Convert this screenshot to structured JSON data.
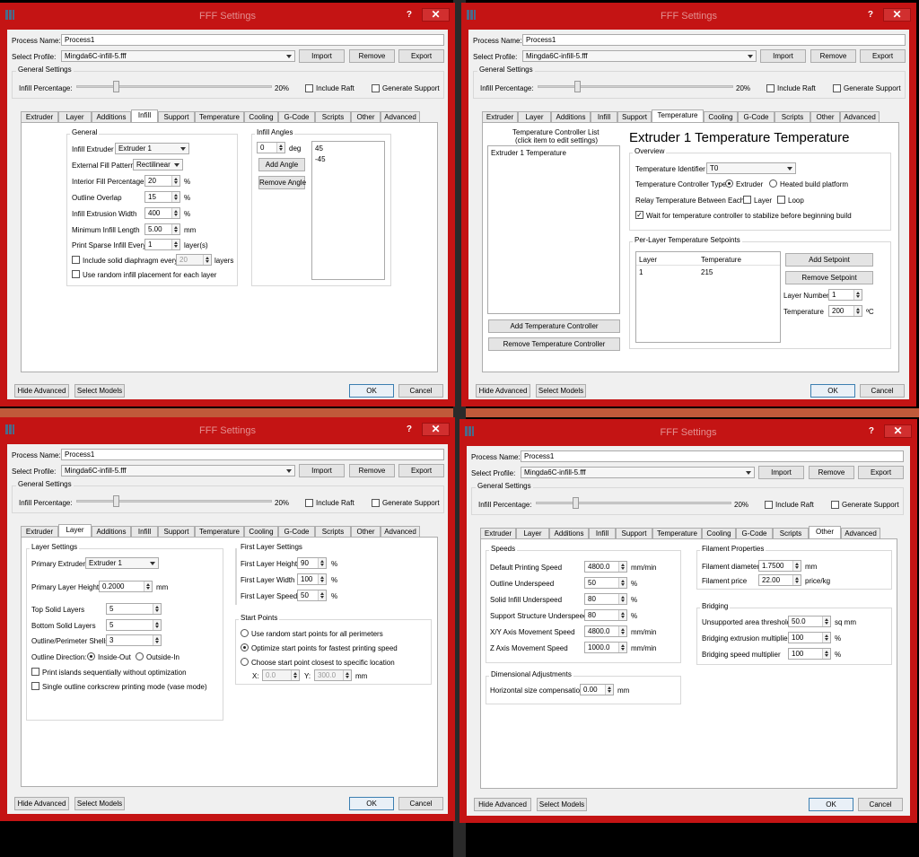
{
  "common": {
    "window_title": "FFF Settings",
    "help": "?",
    "close": "✕",
    "process_label": "Process Name:",
    "process_value": "Process1",
    "profile_label": "Select Profile:",
    "profile_value": "Mingda6C-infill-5.fff",
    "import": "Import",
    "remove": "Remove",
    "export": "Export",
    "general_settings": "General Settings",
    "infill_pct_label": "Infill Percentage:",
    "infill_pct_value": "20%",
    "infill_level": 0.2,
    "include_raft": "Include Raft",
    "generate_support": "Generate Support",
    "hide_advanced": "Hide Advanced",
    "select_models": "Select Models",
    "ok": "OK",
    "cancel": "Cancel"
  },
  "tabs": {
    "extruder": "Extruder",
    "layer": "Layer",
    "additions": "Additions",
    "infill": "Infill",
    "support": "Support",
    "temperature": "Temperature",
    "cooling": "Cooling",
    "gcode": "G-Code",
    "scripts": "Scripts",
    "other": "Other",
    "advanced": "Advanced"
  },
  "infill": {
    "group_general": "General",
    "extruder_label": "Infill Extruder",
    "extruder_value": "Extruder 1",
    "pattern_label": "External Fill Pattern",
    "pattern_value": "Rectilinear",
    "interior_label": "Interior Fill Percentage",
    "interior_value": "20",
    "outline_label": "Outline Overlap",
    "outline_value": "15",
    "width_label": "Infill Extrusion Width",
    "width_value": "400",
    "min_len_label": "Minimum Infill Length",
    "min_len_value": "5.00",
    "unit_pct": "%",
    "unit_mm": "mm",
    "sparse_label": "Print Sparse Infill Every",
    "sparse_value": "1",
    "sparse_unit": "layer(s)",
    "diaphragm_label": "Include solid diaphragm every",
    "diaphragm_value": "20",
    "diaphragm_unit": "layers",
    "random_label": "Use random infill placement for each layer",
    "group_angles": "Infill Angles",
    "angle_value": "0",
    "angle_unit": "deg",
    "add_angle": "Add Angle",
    "remove_angle": "Remove Angle",
    "angles": [
      "45",
      "-45"
    ]
  },
  "temperature": {
    "list_title": "Temperature Controller List",
    "list_sub": "(click item to edit settings)",
    "list_items": [
      "Extruder 1 Temperature"
    ],
    "add_ctrl": "Add Temperature Controller",
    "remove_ctrl": "Remove Temperature Controller",
    "title": "Extruder 1 Temperature Temperature",
    "group_overview": "Overview",
    "id_label": "Temperature Identifier",
    "id_value": "T0",
    "type_label": "Temperature Controller Type:",
    "type_extruder": "Extruder",
    "type_bed": "Heated build platform",
    "relay_label": "Relay Temperature Between Each:",
    "relay_layer": "Layer",
    "relay_loop": "Loop",
    "wait_label": "Wait for temperature controller to stabilize before beginning build",
    "group_setpoints": "Per-Layer Temperature Setpoints",
    "col_layer": "Layer",
    "col_temp": "Temperature",
    "rows": [
      {
        "layer": "1",
        "temp": "215"
      }
    ],
    "add_setpoint": "Add Setpoint",
    "remove_setpoint": "Remove Setpoint",
    "layer_num_label": "Layer Number",
    "layer_num_value": "1",
    "temp_label": "Temperature",
    "temp_value": "200",
    "temp_unit": "ºC"
  },
  "layer": {
    "group_layer": "Layer Settings",
    "primary_label": "Primary Extruder",
    "primary_value": "Extruder 1",
    "height_label": "Primary Layer Height",
    "height_value": "0.2000",
    "height_unit": "mm",
    "top_label": "Top Solid Layers",
    "top_value": "5",
    "bottom_label": "Bottom Solid Layers",
    "bottom_value": "5",
    "shells_label": "Outline/Perimeter Shells",
    "shells_value": "3",
    "direction_label": "Outline Direction:",
    "dir_in": "Inside-Out",
    "dir_out": "Outside-In",
    "islands_label": "Print islands sequentially without optimization",
    "vase_label": "Single outline corkscrew printing mode (vase mode)",
    "group_first": "First Layer Settings",
    "fl_height_label": "First Layer Height",
    "fl_height_value": "90",
    "fl_width_label": "First Layer Width",
    "fl_width_value": "100",
    "fl_speed_label": "First Layer Speed",
    "fl_speed_value": "50",
    "unit_pct": "%",
    "group_start": "Start Points",
    "sp_random": "Use random start points for all perimeters",
    "sp_optimize": "Optimize start points for fastest printing speed",
    "sp_closest": "Choose start point closest to specific location",
    "x_label": "X:",
    "x_value": "0.0",
    "y_label": "Y:",
    "y_value": "300.0",
    "xy_unit": "mm"
  },
  "other": {
    "group_speeds": "Speeds",
    "default_label": "Default Printing Speed",
    "default_value": "4800.0",
    "outline_label": "Outline Underspeed",
    "outline_value": "50",
    "solid_label": "Solid Infill Underspeed",
    "solid_value": "80",
    "support_label": "Support Structure Underspeed",
    "support_value": "80",
    "xy_label": "X/Y Axis Movement Speed",
    "xy_value": "4800.0",
    "z_label": "Z Axis Movement Speed",
    "z_value": "1000.0",
    "unit_mmmin": "mm/min",
    "unit_pct": "%",
    "unit_mm": "mm",
    "group_dim": "Dimensional Adjustments",
    "hcomp_label": "Horizontal size compensation",
    "hcomp_value": "0.00",
    "group_filament": "Filament Properties",
    "diam_label": "Filament diameter",
    "diam_value": "1.7500",
    "price_label": "Filament price",
    "price_value": "22.00",
    "price_unit": "price/kg",
    "group_bridging": "Bridging",
    "area_label": "Unsupported area threshold",
    "area_value": "50.0",
    "area_unit": "sq mm",
    "extmult_label": "Bridging extrusion multiplier",
    "extmult_value": "100",
    "speedmult_label": "Bridging speed multiplier",
    "speedmult_value": "100"
  }
}
